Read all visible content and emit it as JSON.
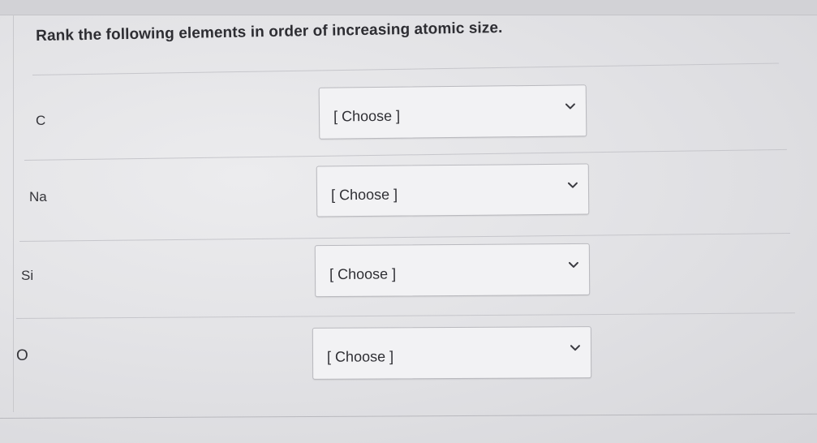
{
  "question": {
    "text": "Rank the following elements in order of increasing atomic size."
  },
  "rows": [
    {
      "element": "C",
      "select_value": "[ Choose ]"
    },
    {
      "element": "Na",
      "select_value": "[ Choose ]"
    },
    {
      "element": "Si",
      "select_value": "[ Choose ]"
    },
    {
      "element": "O",
      "select_value": "[ Choose ]"
    }
  ],
  "icons": {
    "dropdown": "chevron-down-icon"
  },
  "colors": {
    "text": "#2e2e33",
    "select_background": "#f2f2f4",
    "select_border": "#b9b9be"
  }
}
